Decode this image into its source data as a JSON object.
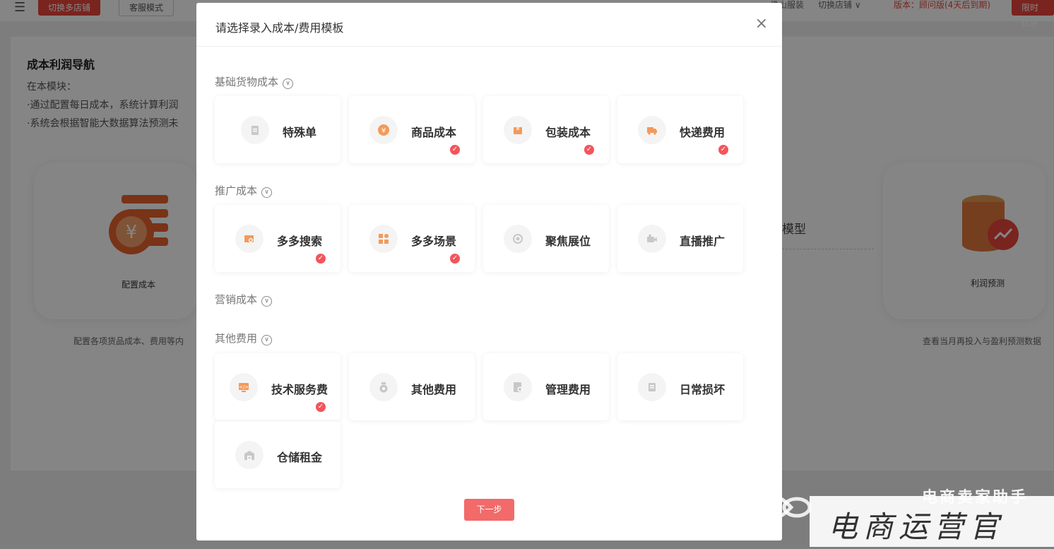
{
  "topbar": {
    "switch_shop_multi": "切换多店铺",
    "service_mode": "客服模式",
    "partial_text_1": "佛山服装",
    "switch_shop": "切换店铺 ∨",
    "version": "版本：顾问版(4天后到期)",
    "limited_offer": "限时优惠"
  },
  "nav": {
    "title": "成本利润导航",
    "line1": "在本模块：",
    "line2": "·通过配置每日成本，系统计算利润",
    "line3": "·系统会根据智能大数据算法预测未"
  },
  "cards": {
    "config_label": "配置成本",
    "config_desc": "配置各项货品成本、费用等内",
    "profit_label": "利润预测",
    "profit_desc": "查看当月再投入与盈利预测数据",
    "model_text": "模型"
  },
  "modal": {
    "title": "请选择录入成本/费用模板",
    "close": "×",
    "next_button": "下一步",
    "sections": [
      {
        "title": "基础货物成本",
        "items": [
          {
            "label": "特殊单",
            "icon": "clipboard-icon",
            "checked": false
          },
          {
            "label": "商品成本",
            "icon": "yen-icon",
            "checked": true
          },
          {
            "label": "包装成本",
            "icon": "package-icon",
            "checked": true
          },
          {
            "label": "快递费用",
            "icon": "truck-icon",
            "checked": true
          }
        ]
      },
      {
        "title": "推广成本",
        "items": [
          {
            "label": "多多搜索",
            "icon": "search-window-icon",
            "checked": true
          },
          {
            "label": "多多场景",
            "icon": "grid-icon",
            "checked": true
          },
          {
            "label": "聚焦展位",
            "icon": "target-icon",
            "checked": false
          },
          {
            "label": "直播推广",
            "icon": "camera-icon",
            "checked": false
          }
        ]
      },
      {
        "title": "营销成本",
        "items": []
      },
      {
        "title": "其他费用",
        "items": [
          {
            "label": "技术服务费",
            "icon": "monitor-code-icon",
            "checked": true
          },
          {
            "label": "其他费用",
            "icon": "money-bag-icon",
            "checked": false
          },
          {
            "label": "管理费用",
            "icon": "document-gear-icon",
            "checked": false
          },
          {
            "label": "日常损坏",
            "icon": "box-icon",
            "checked": false
          },
          {
            "label": "仓储租金",
            "icon": "warehouse-icon",
            "checked": false
          }
        ]
      }
    ]
  },
  "watermark": {
    "brand": "电商卖家助手",
    "stamp": "电商运营官"
  },
  "colors": {
    "accent_red": "#e8453c",
    "check_red": "#f2555a",
    "icon_orange": "#f39a5a",
    "icon_gray": "#c8c8c8"
  }
}
